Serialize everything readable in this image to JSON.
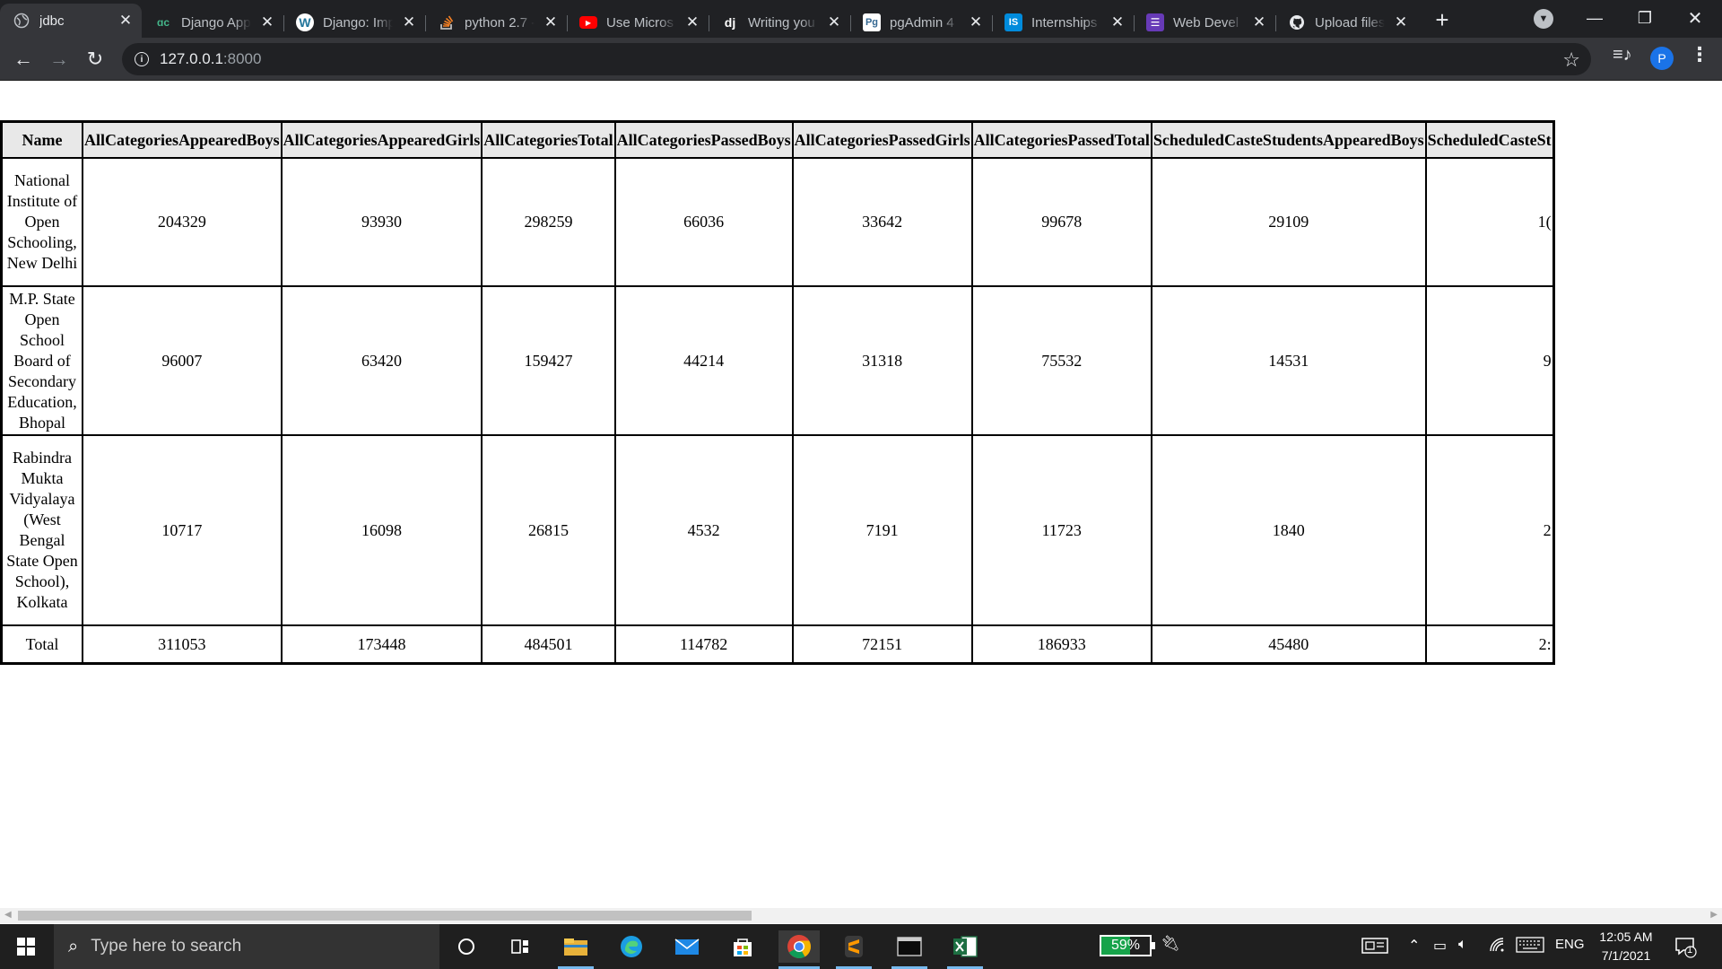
{
  "browser": {
    "tabs": [
      {
        "title": "jdbc",
        "icon": "globe-icon",
        "active": true
      },
      {
        "title": "Django App",
        "icon": "django-green-icon"
      },
      {
        "title": "Django: Imp",
        "icon": "wordpress-icon"
      },
      {
        "title": "python 2.7 -",
        "icon": "stackoverflow-icon"
      },
      {
        "title": "Use Micros",
        "icon": "youtube-icon"
      },
      {
        "title": "Writing you",
        "icon": "django-dj-icon"
      },
      {
        "title": "pgAdmin 4",
        "icon": "pgadmin-icon"
      },
      {
        "title": "Internships",
        "icon": "internshala-icon"
      },
      {
        "title": "Web Devel",
        "icon": "forms-icon"
      },
      {
        "title": "Upload files",
        "icon": "github-icon"
      }
    ],
    "url_host": "127.0.0.1",
    "url_port": ":8000",
    "profile_initial": "P"
  },
  "table": {
    "headers": [
      "Name",
      "AllCategoriesAppearedBoys",
      "AllCategoriesAppearedGirls",
      "AllCategoriesTotal",
      "AllCategoriesPassedBoys",
      "AllCategoriesPassedGirls",
      "AllCategoriesPassedTotal",
      "ScheduledCasteStudentsAppearedBoys",
      "ScheduledCasteSt"
    ],
    "rows": [
      {
        "name": "National Institute of Open Schooling, New Delhi",
        "values": [
          "204329",
          "93930",
          "298259",
          "66036",
          "33642",
          "99678",
          "29109",
          "1("
        ]
      },
      {
        "name": "M.P. State Open School Board of Secondary Education, Bhopal",
        "values": [
          "96007",
          "63420",
          "159427",
          "44214",
          "31318",
          "75532",
          "14531",
          "9"
        ]
      },
      {
        "name": "Rabindra Mukta Vidyalaya (West Bengal State Open School), Kolkata",
        "values": [
          "10717",
          "16098",
          "26815",
          "4532",
          "7191",
          "11723",
          "1840",
          "2"
        ]
      }
    ],
    "total": {
      "label": "Total",
      "values": [
        "311053",
        "173448",
        "484501",
        "114782",
        "72151",
        "186933",
        "45480",
        "2:"
      ]
    }
  },
  "taskbar": {
    "search_placeholder": "Type here to search",
    "battery": "59%",
    "language": "ENG",
    "time": "12:05 AM",
    "date": "7/1/2021",
    "notifications": "1"
  },
  "colors": {
    "chrome_dark": "#202124",
    "chrome_toolbar": "#35363a",
    "header_bg": "#e8e8e8",
    "taskbar": "#1f1f1f",
    "battery_fill": "#16a34a"
  }
}
